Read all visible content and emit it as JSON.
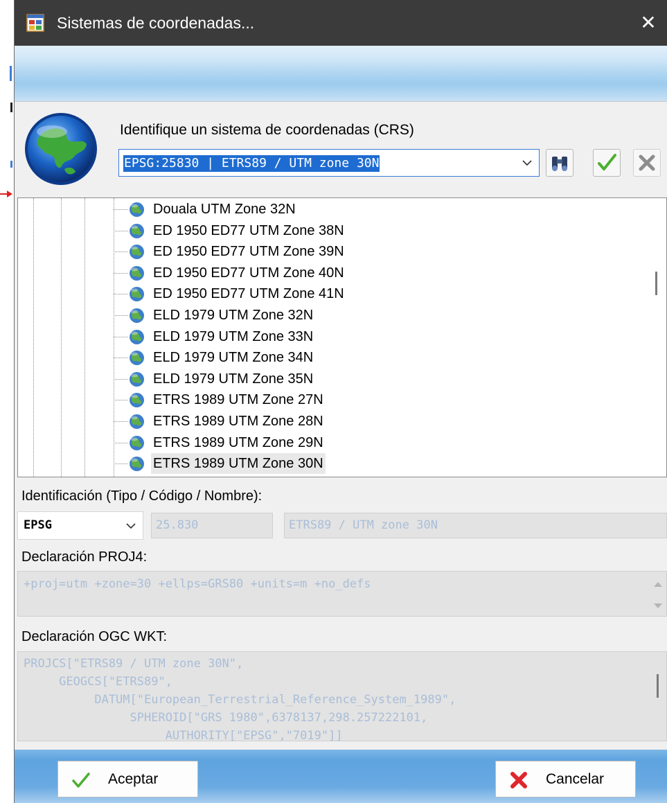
{
  "window": {
    "title": "Sistemas de coordenadas...",
    "close_glyph": "✕"
  },
  "header": {
    "prompt": "Identifique un sistema de coordenadas (CRS)",
    "crs_selected": "EPSG:25830 | ETRS89 / UTM zone 30N",
    "icons": [
      "globe-icon",
      "binoculars-icon",
      "checkmark-icon",
      "delete-x-icon"
    ]
  },
  "tree": {
    "items": [
      {
        "label": "Douala UTM Zone 32N"
      },
      {
        "label": "ED 1950 ED77 UTM Zone 38N"
      },
      {
        "label": "ED 1950 ED77 UTM Zone 39N"
      },
      {
        "label": "ED 1950 ED77 UTM Zone 40N"
      },
      {
        "label": "ED 1950 ED77 UTM Zone 41N"
      },
      {
        "label": "ELD 1979 UTM Zone 32N"
      },
      {
        "label": "ELD 1979 UTM Zone 33N"
      },
      {
        "label": "ELD 1979 UTM Zone 34N"
      },
      {
        "label": "ELD 1979 UTM Zone 35N"
      },
      {
        "label": "ETRS 1989 UTM Zone 27N"
      },
      {
        "label": "ETRS 1989 UTM Zone 28N"
      },
      {
        "label": "ETRS 1989 UTM Zone 29N"
      },
      {
        "label": "ETRS 1989 UTM Zone 30N"
      }
    ],
    "selected_index": 12
  },
  "identification": {
    "label": "Identificación (Tipo / Código / Nombre):",
    "type": "EPSG",
    "code": "25.830",
    "name": "ETRS89 / UTM zone 30N"
  },
  "proj4": {
    "label": "Declaración PROJ4:",
    "value": "+proj=utm +zone=30 +ellps=GRS80 +units=m +no_defs"
  },
  "wkt": {
    "label": "Declaración OGC WKT:",
    "lines": [
      "PROJCS[\"ETRS89 / UTM zone 30N\",",
      "     GEOGCS[\"ETRS89\",",
      "          DATUM[\"European_Terrestrial_Reference_System_1989\",",
      "               SPHEROID[\"GRS 1980\",6378137,298.257222101,",
      "                    AUTHORITY[\"EPSG\",\"7019\"]]"
    ]
  },
  "footer": {
    "accept_label": "Aceptar",
    "cancel_label": "Cancelar"
  },
  "colors": {
    "titlebar": "#3b3b3b",
    "selection": "#1e6cd1",
    "readonly_text": "#a9bed8",
    "accept_green": "#4caf32",
    "cancel_red": "#e0262d"
  }
}
